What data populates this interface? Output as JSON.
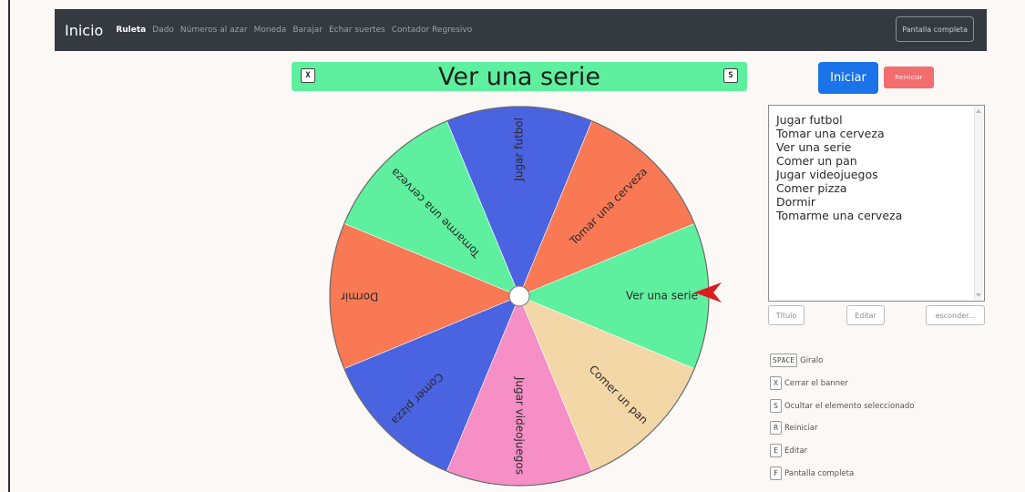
{
  "navbar": {
    "brand": "Inicio",
    "items": [
      "Ruleta",
      "Dado",
      "Números al azar",
      "Moneda",
      "Barajar",
      "Echar suertes",
      "Contador Regresivo"
    ],
    "fullscreen_label": "Pantalla completa"
  },
  "banner": {
    "title": "Ver una serie",
    "close_key": "X",
    "hide_key": "S",
    "color": "#5ef09e"
  },
  "wheel": {
    "segments": [
      {
        "label": "Jugar futbol",
        "color": "#4a63e0"
      },
      {
        "label": "Tomar una cerveza",
        "color": "#f97955"
      },
      {
        "label": "Ver una serie",
        "color": "#5ef09e"
      },
      {
        "label": "Comer un pan",
        "color": "#f3d7a6"
      },
      {
        "label": "Jugar videojuegos",
        "color": "#f58fc6"
      },
      {
        "label": "Comer pizza",
        "color": "#4a63e0"
      },
      {
        "label": "Dormir",
        "color": "#f97955"
      },
      {
        "label": "Tomarme una cerveza",
        "color": "#5ef09e"
      }
    ],
    "pointer_color": "#d91e1e"
  },
  "controls": {
    "start_label": "Iniciar",
    "reset_label": "Reiniciar",
    "title_label": "Título",
    "edit_label": "Editar",
    "hide_label": "esconder..."
  },
  "options": [
    "Jugar futbol",
    "Tomar una cerveza",
    "Ver una serie",
    "Comer un pan",
    "Jugar videojuegos",
    "Comer pizza",
    "Dormir",
    "Tomarme una cerveza"
  ],
  "shortcuts": [
    {
      "key": "SPACE",
      "desc": "Giralo"
    },
    {
      "key": "X",
      "desc": "Cerrar el banner"
    },
    {
      "key": "S",
      "desc": "Ocultar el elemento seleccionado"
    },
    {
      "key": "R",
      "desc": "Reiniciar"
    },
    {
      "key": "E",
      "desc": "Editar"
    },
    {
      "key": "F",
      "desc": "Pantalla completa"
    }
  ]
}
